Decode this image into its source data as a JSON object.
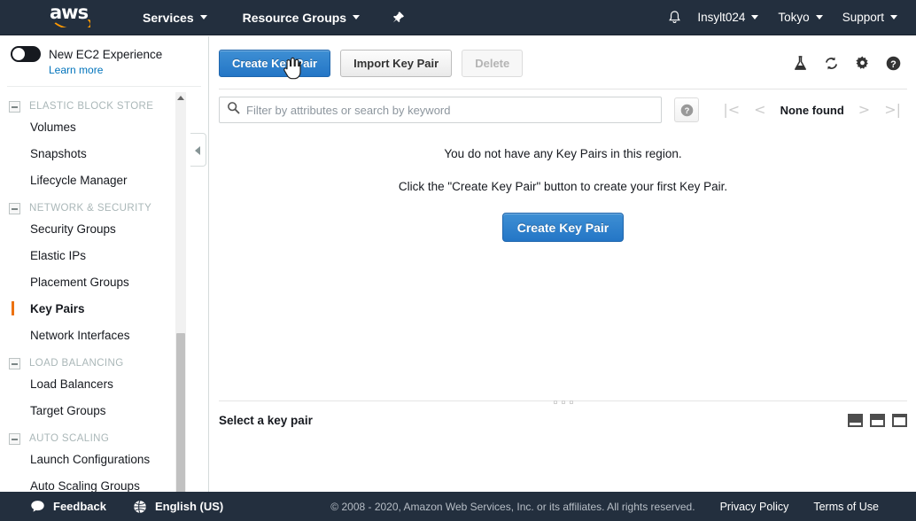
{
  "topnav": {
    "logo_text": "aws",
    "services": "Services",
    "resource_groups": "Resource Groups",
    "pin_icon": "pin-icon",
    "bell_icon": "bell-icon",
    "account": "Insylt024",
    "region": "Tokyo",
    "support": "Support"
  },
  "sidebar": {
    "experience_toggle_label": "New EC2 Experience",
    "learn_more": "Learn more",
    "sections": [
      {
        "title": "ELASTIC BLOCK STORE",
        "items": [
          "Volumes",
          "Snapshots",
          "Lifecycle Manager"
        ]
      },
      {
        "title": "NETWORK & SECURITY",
        "items": [
          "Security Groups",
          "Elastic IPs",
          "Placement Groups",
          "Key Pairs",
          "Network Interfaces"
        ]
      },
      {
        "title": "LOAD BALANCING",
        "items": [
          "Load Balancers",
          "Target Groups"
        ]
      },
      {
        "title": "AUTO SCALING",
        "items": [
          "Launch Configurations",
          "Auto Scaling Groups"
        ]
      }
    ],
    "active_item": "Key Pairs"
  },
  "toolbar": {
    "create_label": "Create Key Pair",
    "import_label": "Import Key Pair",
    "delete_label": "Delete",
    "delete_disabled": true,
    "icons": [
      "flask-icon",
      "refresh-icon",
      "gear-icon",
      "help-icon"
    ]
  },
  "filter": {
    "placeholder": "Filter by attributes or search by keyword",
    "value": "",
    "search_icon": "search-icon",
    "help_icon": "help-icon"
  },
  "pagination": {
    "first": "|<",
    "prev": "<",
    "label": "None found",
    "next": ">",
    "last": ">|"
  },
  "empty_state": {
    "line1": "You do not have any Key Pairs in this region.",
    "line2": "Click the \"Create Key Pair\" button to create your first Key Pair.",
    "button_label": "Create Key Pair"
  },
  "detail_panel": {
    "title": "Select a key pair",
    "layout_icons": [
      "layout-small-icon",
      "layout-medium-icon",
      "layout-large-icon"
    ]
  },
  "footer": {
    "feedback": "Feedback",
    "feedback_icon": "feedback-icon",
    "language": "English (US)",
    "globe_icon": "globe-icon",
    "copyright": "© 2008 - 2020, Amazon Web Services, Inc. or its affiliates. All rights reserved.",
    "privacy": "Privacy Policy",
    "terms": "Terms of Use"
  },
  "colors": {
    "nav_bg": "#232f3e",
    "accent_orange": "#ec7211",
    "primary_blue": "#2476c6",
    "link_blue": "#0073bb"
  }
}
